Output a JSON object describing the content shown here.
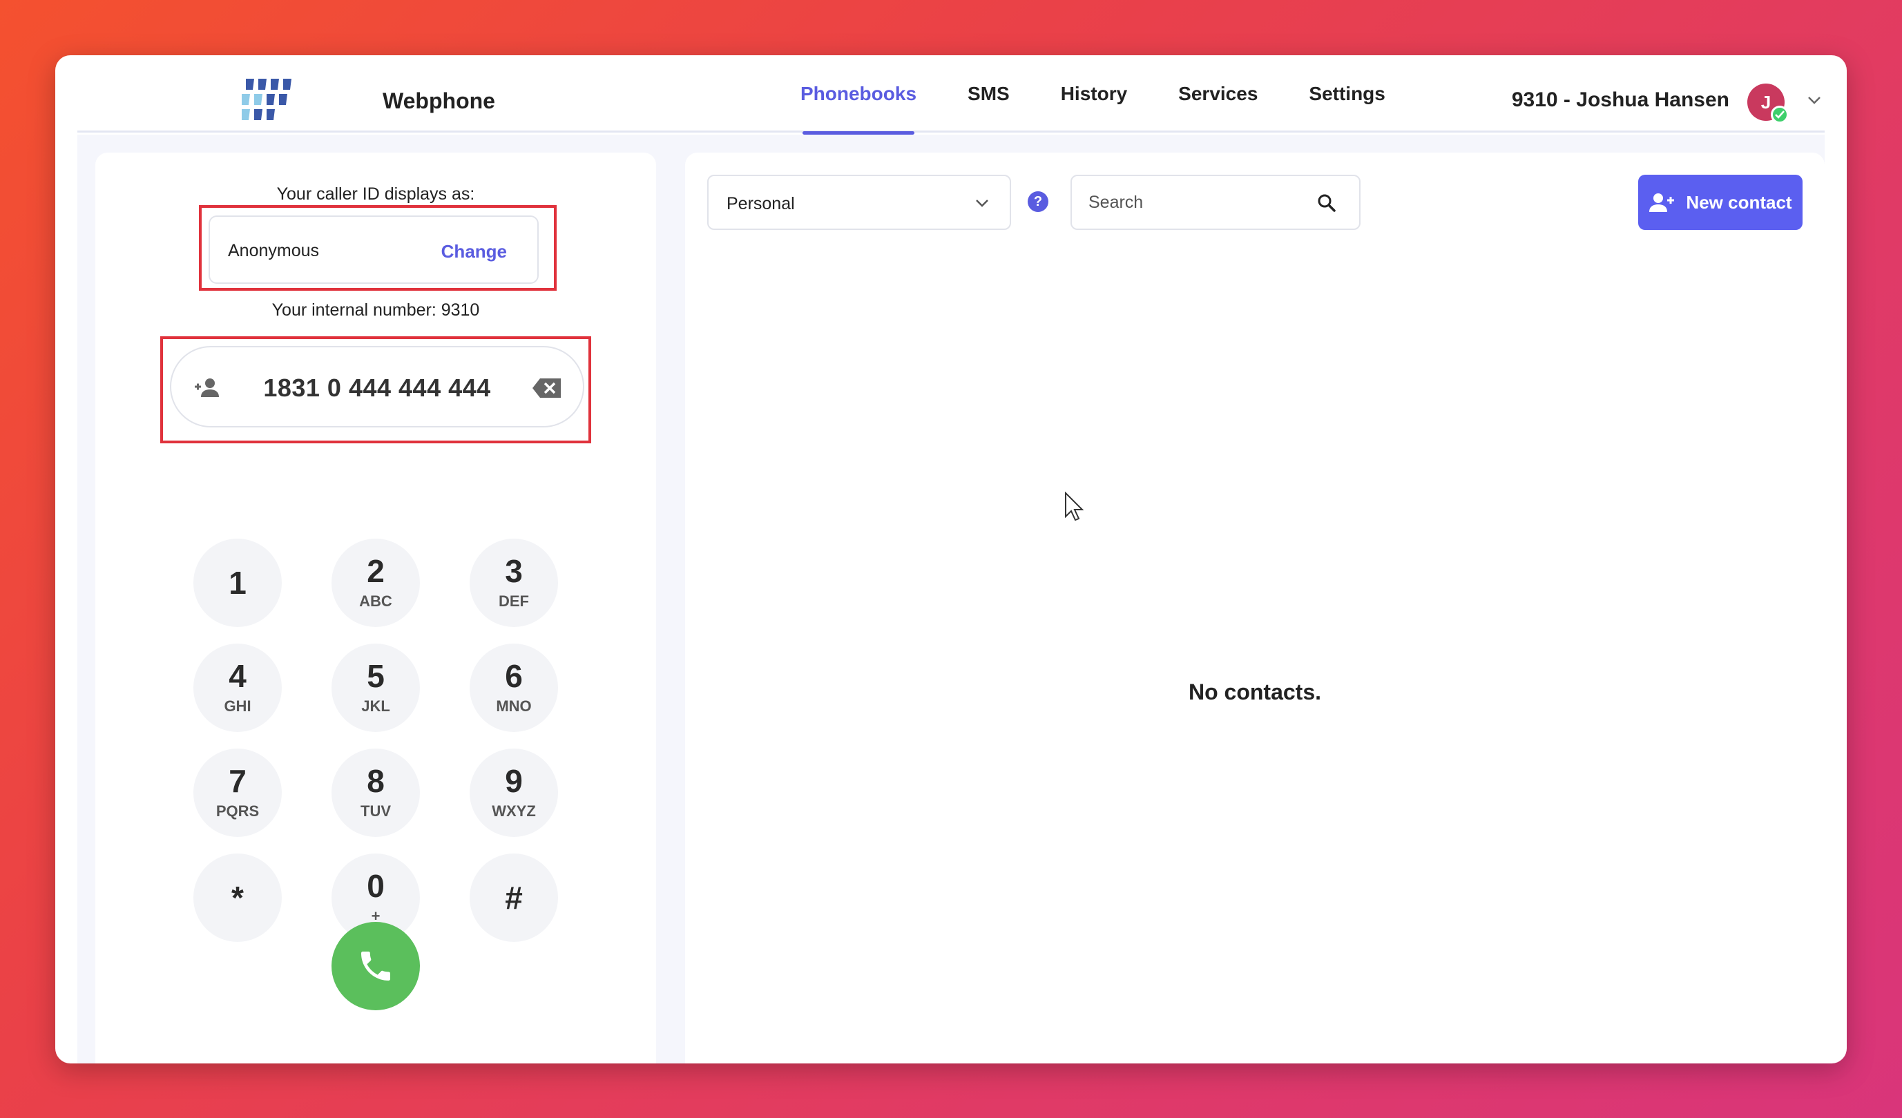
{
  "app": {
    "name": "Webphone"
  },
  "nav": {
    "items": [
      {
        "label": "Phonebooks",
        "active": true
      },
      {
        "label": "SMS",
        "active": false
      },
      {
        "label": "History",
        "active": false
      },
      {
        "label": "Services",
        "active": false
      },
      {
        "label": "Settings",
        "active": false
      }
    ]
  },
  "user": {
    "label": "9310 - Joshua Hansen",
    "initial": "J",
    "avatar_color": "#c9395e",
    "status": "online"
  },
  "dialer": {
    "caller_id_title": "Your caller ID displays as:",
    "caller_id_value": "Anonymous",
    "change_label": "Change",
    "internal_number": "Your internal number: 9310",
    "number": "1831 0 444 444 444",
    "keys": [
      {
        "digit": "1",
        "letters": ""
      },
      {
        "digit": "2",
        "letters": "ABC"
      },
      {
        "digit": "3",
        "letters": "DEF"
      },
      {
        "digit": "4",
        "letters": "GHI"
      },
      {
        "digit": "5",
        "letters": "JKL"
      },
      {
        "digit": "6",
        "letters": "MNO"
      },
      {
        "digit": "7",
        "letters": "PQRS"
      },
      {
        "digit": "8",
        "letters": "TUV"
      },
      {
        "digit": "9",
        "letters": "WXYZ"
      },
      {
        "digit": "*",
        "letters": ""
      },
      {
        "digit": "0",
        "letters": "+"
      },
      {
        "digit": "#",
        "letters": ""
      }
    ]
  },
  "phonebook": {
    "selected": "Personal",
    "search_placeholder": "Search",
    "new_contact_label": "New contact",
    "empty_text": "No contacts."
  },
  "colors": {
    "accent": "#5a5ce0",
    "primary_button": "#5b5ff0",
    "call_green": "#5bbf5c",
    "highlight_red": "#e0323c"
  }
}
